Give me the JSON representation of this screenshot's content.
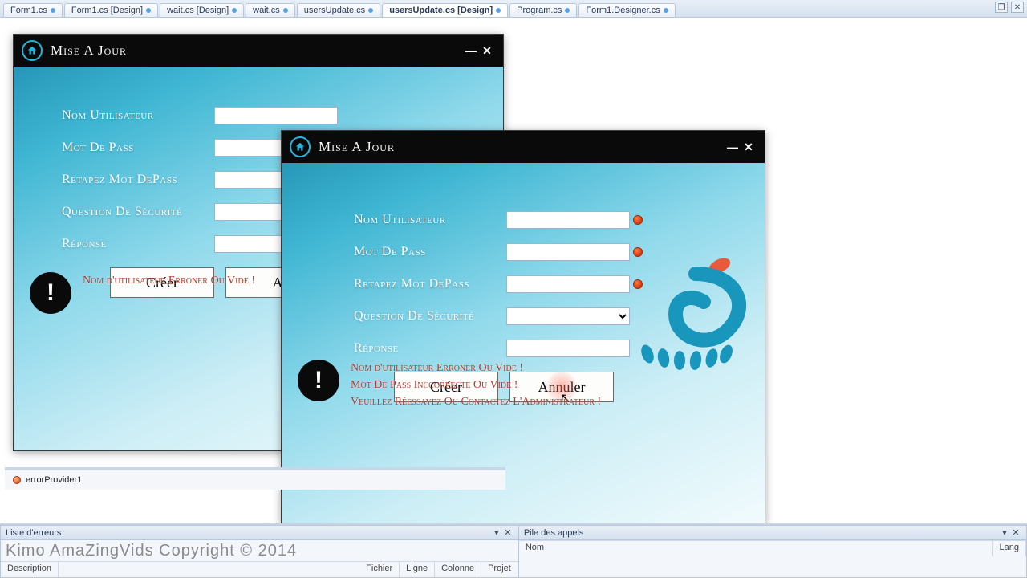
{
  "tabs": {
    "items": [
      {
        "label": "Form1.cs"
      },
      {
        "label": "Form1.cs [Design]"
      },
      {
        "label": "wait.cs [Design]"
      },
      {
        "label": "wait.cs"
      },
      {
        "label": "usersUpdate.cs"
      },
      {
        "label": "usersUpdate.cs [Design]",
        "active": true
      },
      {
        "label": "Program.cs"
      },
      {
        "label": "Form1.Designer.cs"
      }
    ],
    "restore": "❐",
    "close": "✕"
  },
  "form": {
    "title": "Mise A Jour",
    "minimize": "—",
    "close": "✕",
    "labels": {
      "user": "Nom Utilisateur",
      "pass": "Mot De Pass",
      "pass2": "Retapez Mot DePass",
      "question": "Question De Sécurité",
      "answer": "Réponse"
    },
    "buttons": {
      "create": "Créer",
      "cancel": "Annuler"
    },
    "error": {
      "line1": "Nom d'utilisateur Erroner Ou  Vide !",
      "line2": "Mot De Pass Inccorrecte Ou  Vide !",
      "line3": "Veuillez Réessayez Ou Contactez L'Administrateur !"
    }
  },
  "tray": {
    "item": "errorProvider1"
  },
  "panels": {
    "errors": {
      "title": "Liste d'erreurs",
      "pin": "▾",
      "close": "✕",
      "watermark": "Kimo AmaZingVids Copyright © 2014",
      "cols": [
        "Description",
        "Fichier",
        "Ligne",
        "Colonne",
        "Projet"
      ]
    },
    "callstack": {
      "title": "Pile des appels",
      "pin": "▾",
      "close": "✕",
      "cols": [
        "Nom",
        "Lang"
      ]
    }
  }
}
